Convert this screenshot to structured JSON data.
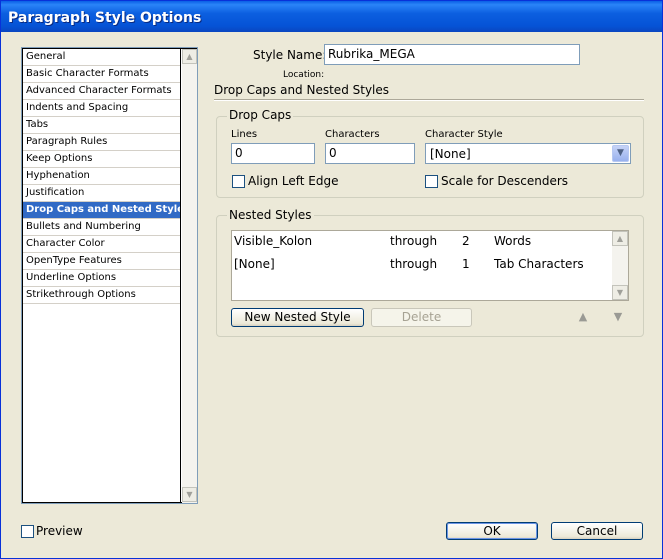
{
  "window": {
    "title": "Paragraph Style Options"
  },
  "sidebar": {
    "items": [
      {
        "label": "General",
        "selected": false
      },
      {
        "label": "Basic Character Formats",
        "selected": false
      },
      {
        "label": "Advanced Character Formats",
        "selected": false
      },
      {
        "label": "Indents and Spacing",
        "selected": false
      },
      {
        "label": "Tabs",
        "selected": false
      },
      {
        "label": "Paragraph Rules",
        "selected": false
      },
      {
        "label": "Keep Options",
        "selected": false
      },
      {
        "label": "Hyphenation",
        "selected": false
      },
      {
        "label": "Justification",
        "selected": false
      },
      {
        "label": "Drop Caps and Nested Styles",
        "selected": true
      },
      {
        "label": "Bullets and Numbering",
        "selected": false
      },
      {
        "label": "Character Color",
        "selected": false
      },
      {
        "label": "OpenType Features",
        "selected": false
      },
      {
        "label": "Underline Options",
        "selected": false
      },
      {
        "label": "Strikethrough Options",
        "selected": false
      }
    ]
  },
  "header": {
    "style_name_label": "Style Name:",
    "style_name_value": "Rubrika_MEGA",
    "location_label": "Location:"
  },
  "section": {
    "title": "Drop Caps and Nested Styles"
  },
  "drop_caps": {
    "group_title": "Drop Caps",
    "lines_label": "Lines",
    "lines_value": "0",
    "characters_label": "Characters",
    "characters_value": "0",
    "character_style_label": "Character Style",
    "character_style_value": "[None]",
    "align_left_edge_label": "Align Left Edge",
    "align_left_edge_checked": false,
    "scale_descenders_label": "Scale for Descenders",
    "scale_descenders_checked": false
  },
  "nested_styles": {
    "group_title": "Nested Styles",
    "rows": [
      {
        "style": "Visible_Kolon",
        "mode": "through",
        "count": "2",
        "unit": "Words"
      },
      {
        "style": "[None]",
        "mode": "through",
        "count": "1",
        "unit": "Tab Characters"
      }
    ],
    "new_button": "New Nested Style",
    "delete_button": "Delete"
  },
  "footer": {
    "preview_label": "Preview",
    "preview_checked": false,
    "ok_label": "OK",
    "cancel_label": "Cancel"
  },
  "icons": {
    "scroll_up": "▲",
    "scroll_down": "▼",
    "dropdown": "▼",
    "move_up": "▲",
    "move_down": "▼"
  },
  "colors": {
    "selection": "#316ac5",
    "titlebar": "#0a5fe6",
    "dialog_bg": "#ece9d8"
  }
}
